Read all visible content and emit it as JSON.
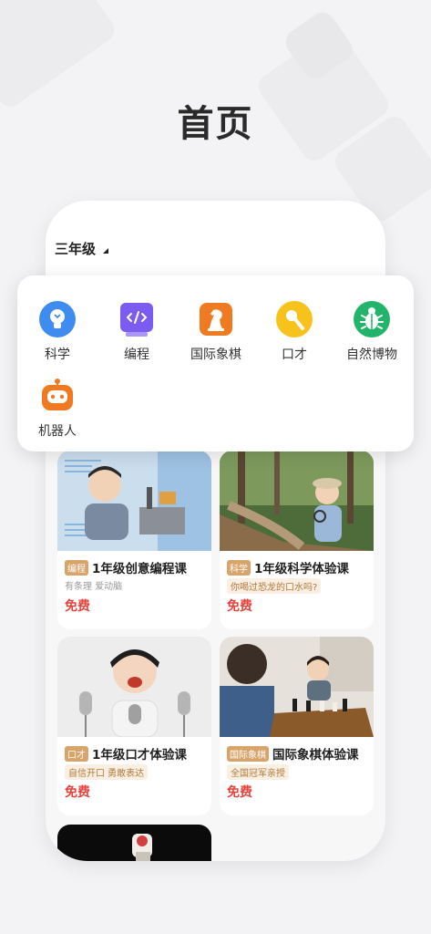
{
  "hero": {
    "title": "首页"
  },
  "grade": {
    "label": "三年级"
  },
  "categories": [
    {
      "label": "科学",
      "icon": "lightbulb-icon",
      "color": "#3f8cf0"
    },
    {
      "label": "编程",
      "icon": "code-icon",
      "color": "#7b5cf0"
    },
    {
      "label": "国际象棋",
      "icon": "chess-knight-icon",
      "color": "#f07a22"
    },
    {
      "label": "口才",
      "icon": "microphone-icon",
      "color": "#f6c21b"
    },
    {
      "label": "自然博物",
      "icon": "beetle-icon",
      "color": "#23b46c"
    },
    {
      "label": "机器人",
      "icon": "robot-icon",
      "color": "#f07a22"
    }
  ],
  "courses": [
    {
      "tag": "编程",
      "title": "1年级创意编程课",
      "sub": "有条理 爱动脑",
      "price": "免费"
    },
    {
      "tag": "科学",
      "title": "1年级科学体验课",
      "sub": "你喝过恐龙的口水吗?",
      "price": "免费"
    },
    {
      "tag": "口才",
      "title": "1年级口才体验课",
      "sub": "自信开口 勇敢表达",
      "price": "免费"
    },
    {
      "tag": "国际象棋",
      "title": "国际象棋体验课",
      "sub": "全国冠军亲授",
      "price": "免费"
    }
  ]
}
